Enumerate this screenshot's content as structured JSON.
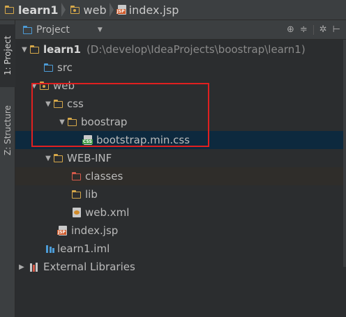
{
  "breadcrumb": [
    {
      "label": "learn1",
      "icon": "module-folder-icon"
    },
    {
      "label": "web",
      "icon": "folder-icon"
    },
    {
      "label": "index.jsp",
      "icon": "jsp-file-icon"
    }
  ],
  "toolstrip": {
    "project_tab": "1: Project",
    "structure_tab": "Z: Structure"
  },
  "panel": {
    "view_label": "Project"
  },
  "tree": {
    "root_label": "learn1",
    "root_path": "(D:\\develop\\IdeaProjects\\boostrap\\learn1)",
    "src": "src",
    "web": "web",
    "css": "css",
    "boostrap": "boostrap",
    "bootstrap_css": "bootstrap.min.css",
    "webinf": "WEB-INF",
    "classes": "classes",
    "lib": "lib",
    "webxml": "web.xml",
    "indexjsp": "index.jsp",
    "iml": "learn1.iml",
    "external": "External Libraries"
  },
  "colors": {
    "background": "#2b2d2f",
    "selection": "#0d293e",
    "folder": "#d6a84a",
    "annotation": "#e02020"
  }
}
